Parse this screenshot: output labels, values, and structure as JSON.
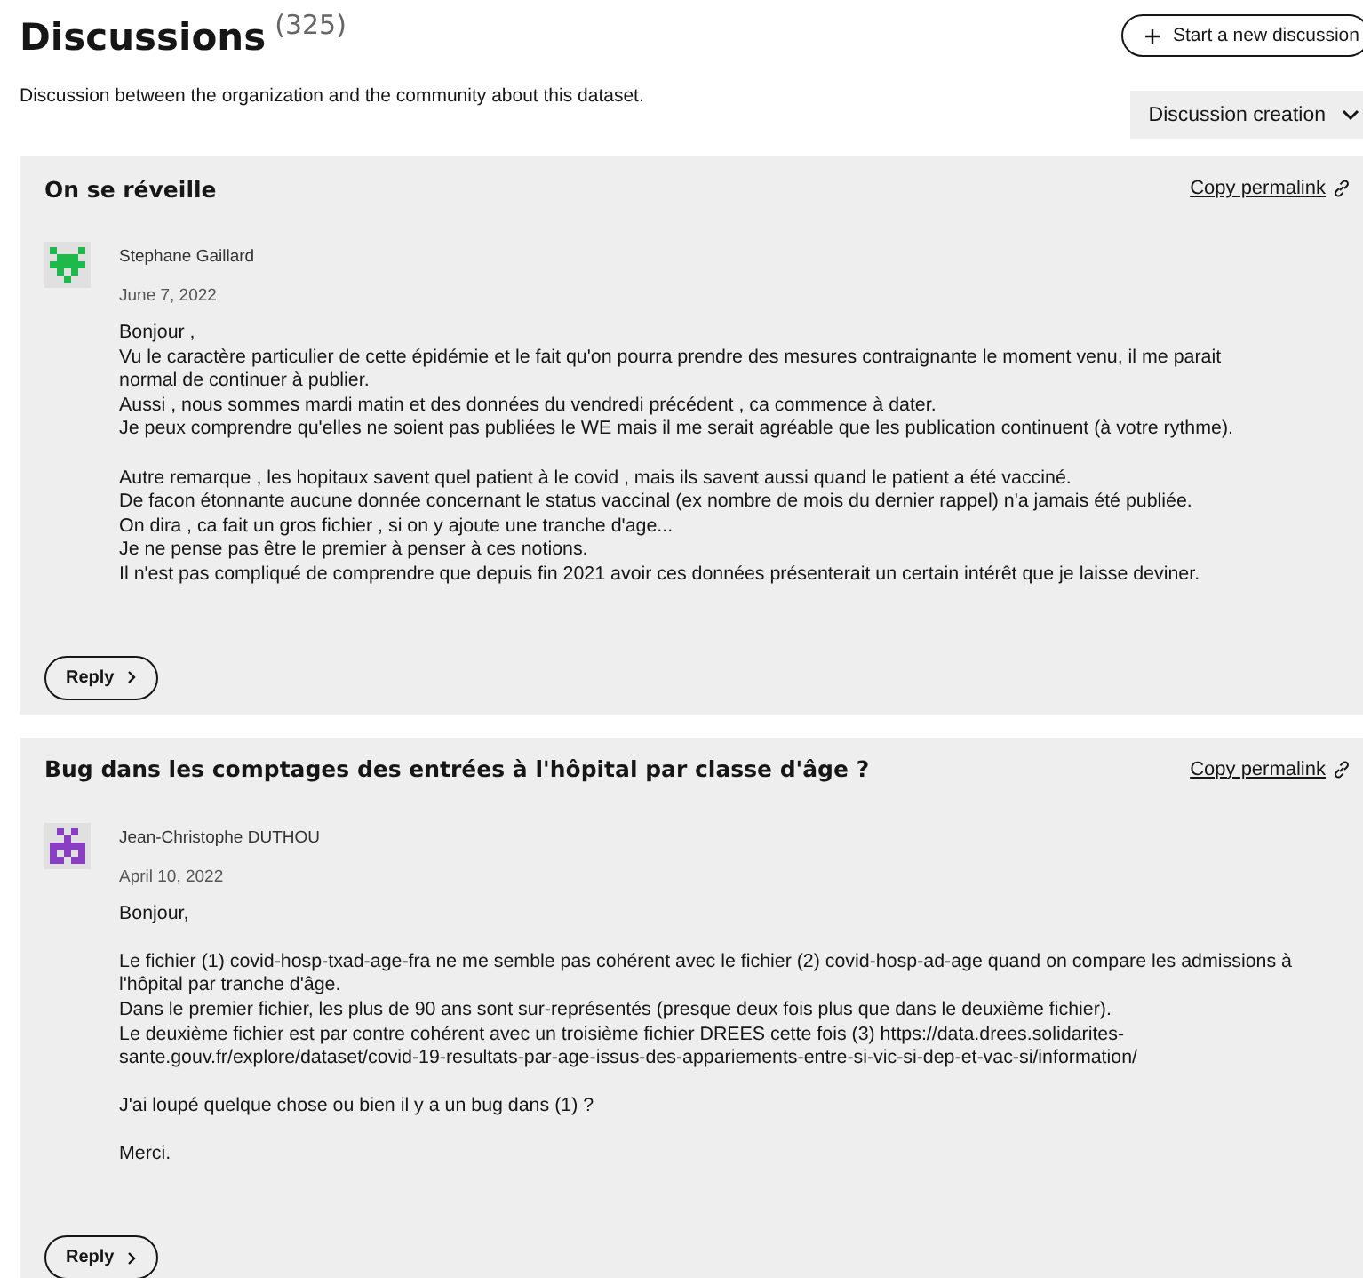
{
  "header": {
    "title": "Discussions",
    "count": "(325)",
    "new_button": "Start a new discussion",
    "description": "Discussion between the organization and the community about this dataset.",
    "sort": "Discussion creation"
  },
  "discussions": [
    {
      "title": "On se réveille",
      "permalink": "Copy permalink",
      "author": "Stephane Gaillard",
      "date": "June 7, 2022",
      "color": "#1fb84a",
      "paragraphs": [
        [
          "Bonjour ,",
          "Vu le caractère particulier de cette épidémie et le fait qu'on pourra prendre des mesures contraignante le moment venu, il me parait",
          "normal de continuer à publier.",
          "Aussi , nous sommes mardi matin et des données du vendredi précédent , ca commence à dater.",
          "Je peux comprendre qu'elles ne soient pas publiées le WE mais il me serait agréable que les publication continuent (à votre rythme)."
        ],
        [
          "Autre remarque , les hopitaux savent quel patient à le covid , mais ils savent aussi quand le patient a été vacciné.",
          "De facon étonnante aucune donnée concernant le status vaccinal (ex nombre de mois du dernier rappel) n'a jamais été publiée.",
          "On dira , ca fait un gros fichier , si on y ajoute une tranche d'age...",
          "Je ne pense pas être le premier à penser à ces notions.",
          "Il n'est pas compliqué de comprendre que depuis fin 2021 avoir ces données présenterait un certain intérêt que je laisse deviner."
        ]
      ],
      "reply": "Reply"
    },
    {
      "title": "Bug dans les comptages des entrées à l'hôpital par classe d'âge ?",
      "permalink": "Copy permalink",
      "author": "Jean-Christophe DUTHOU",
      "date": "April 10, 2022",
      "color": "#8a3fc2",
      "paragraphs": [
        [
          "Bonjour,"
        ],
        [
          "Le fichier (1) covid-hosp-txad-age-fra ne me semble pas cohérent avec le fichier (2) covid-hosp-ad-age quand on compare les admissions à",
          "l'hôpital par tranche d'âge.",
          "Dans le premier fichier, les plus de 90 ans sont sur-représentés (presque deux fois plus que dans le deuxième fichier).",
          "Le deuxième fichier est par contre cohérent avec un troisième fichier DREES cette fois (3) https://data.drees.solidarites-",
          "sante.gouv.fr/explore/dataset/covid-19-resultats-par-age-issus-des-appariements-entre-si-vic-si-dep-et-vac-si/information/"
        ],
        [
          "J'ai loupé quelque chose ou bien il y a un bug dans (1) ?"
        ],
        [
          "Merci."
        ]
      ],
      "reply": "Reply"
    }
  ]
}
